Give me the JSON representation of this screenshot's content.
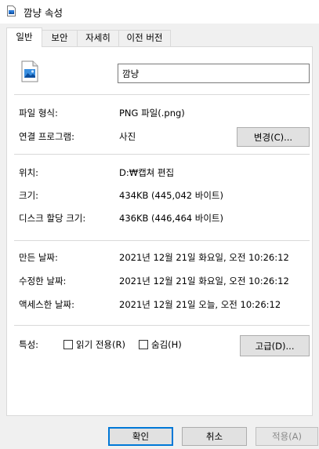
{
  "window": {
    "title": "깜냥 속성"
  },
  "tabs": [
    {
      "label": "일반"
    },
    {
      "label": "보안"
    },
    {
      "label": "자세히"
    },
    {
      "label": "이전 버전"
    }
  ],
  "general": {
    "file_name": "깜냥",
    "rows": [
      {
        "label": "파일 형식:",
        "value": "PNG 파일(.png)"
      },
      {
        "label": "연결 프로그램:",
        "value": "사진"
      },
      {
        "label": "위치:",
        "value": "D:₩캡쳐 편집"
      },
      {
        "label": "크기:",
        "value": "434KB (445,042 바이트)"
      },
      {
        "label": "디스크 할당 크기:",
        "value": "436KB (446,464 바이트)"
      },
      {
        "label": "만든 날짜:",
        "value": "2021년 12월 21일 화요일, 오전 10:26:12"
      },
      {
        "label": "수정한 날짜:",
        "value": "2021년 12월 21일 화요일, 오전 10:26:12"
      },
      {
        "label": "액세스한 날짜:",
        "value": "2021년 12월 21일 오늘, 오전 10:26:12"
      }
    ],
    "change_button": "변경(C)...",
    "attributes_label": "특성:",
    "readonly_label": "읽기 전용(R)",
    "hidden_label": "숨김(H)",
    "readonly_checked": false,
    "hidden_checked": false,
    "advanced_button": "고급(D)..."
  },
  "footer": {
    "ok": "확인",
    "cancel": "취소",
    "apply": "적용(A)"
  },
  "colors": {
    "accent": "#0078d7",
    "border": "#d9d9d9",
    "background": "#f0f0f0"
  }
}
